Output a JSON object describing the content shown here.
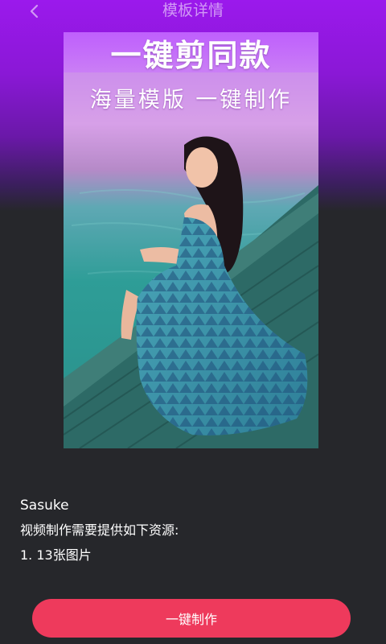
{
  "header": {
    "title": "模板详情",
    "back_icon": "chevron-left-icon"
  },
  "preview": {
    "title": "一键剪同款",
    "subtitle": "海量模版  一键制作"
  },
  "info": {
    "author": "Sasuke",
    "requirement": "视频制作需要提供如下资源:",
    "resource": "1. 13张图片"
  },
  "actions": {
    "make_label": "一键制作"
  },
  "colors": {
    "header_gradient_top": "#9b19ec",
    "background": "#26272b",
    "button": "#ee3a5c"
  }
}
